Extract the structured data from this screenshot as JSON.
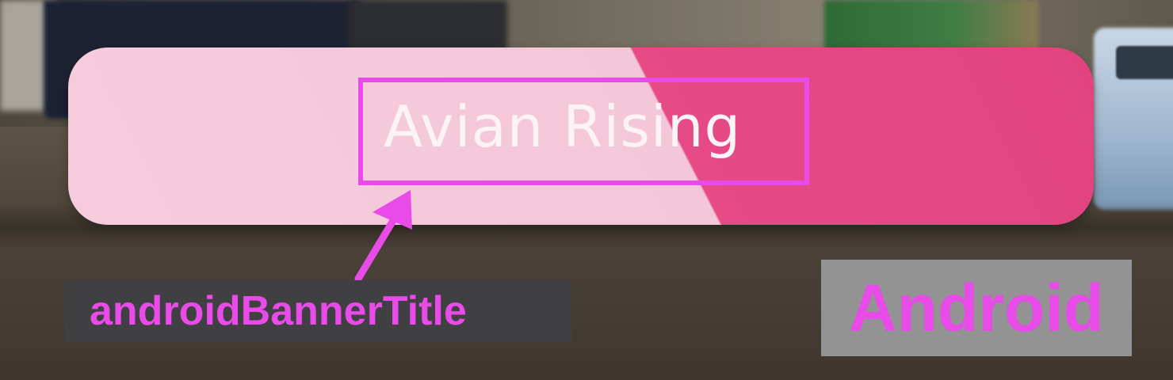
{
  "banner": {
    "title": "Avian Rising",
    "colors": {
      "light_pink": "#f3c7d8",
      "hot_pink": "#e2437f",
      "title_text": "#fbf3f6"
    }
  },
  "annotation": {
    "element_label": "androidBannerTitle",
    "platform_label": "Android",
    "highlight_color": "#e84be8",
    "arrow_icon": "arrow-up-right-icon"
  }
}
